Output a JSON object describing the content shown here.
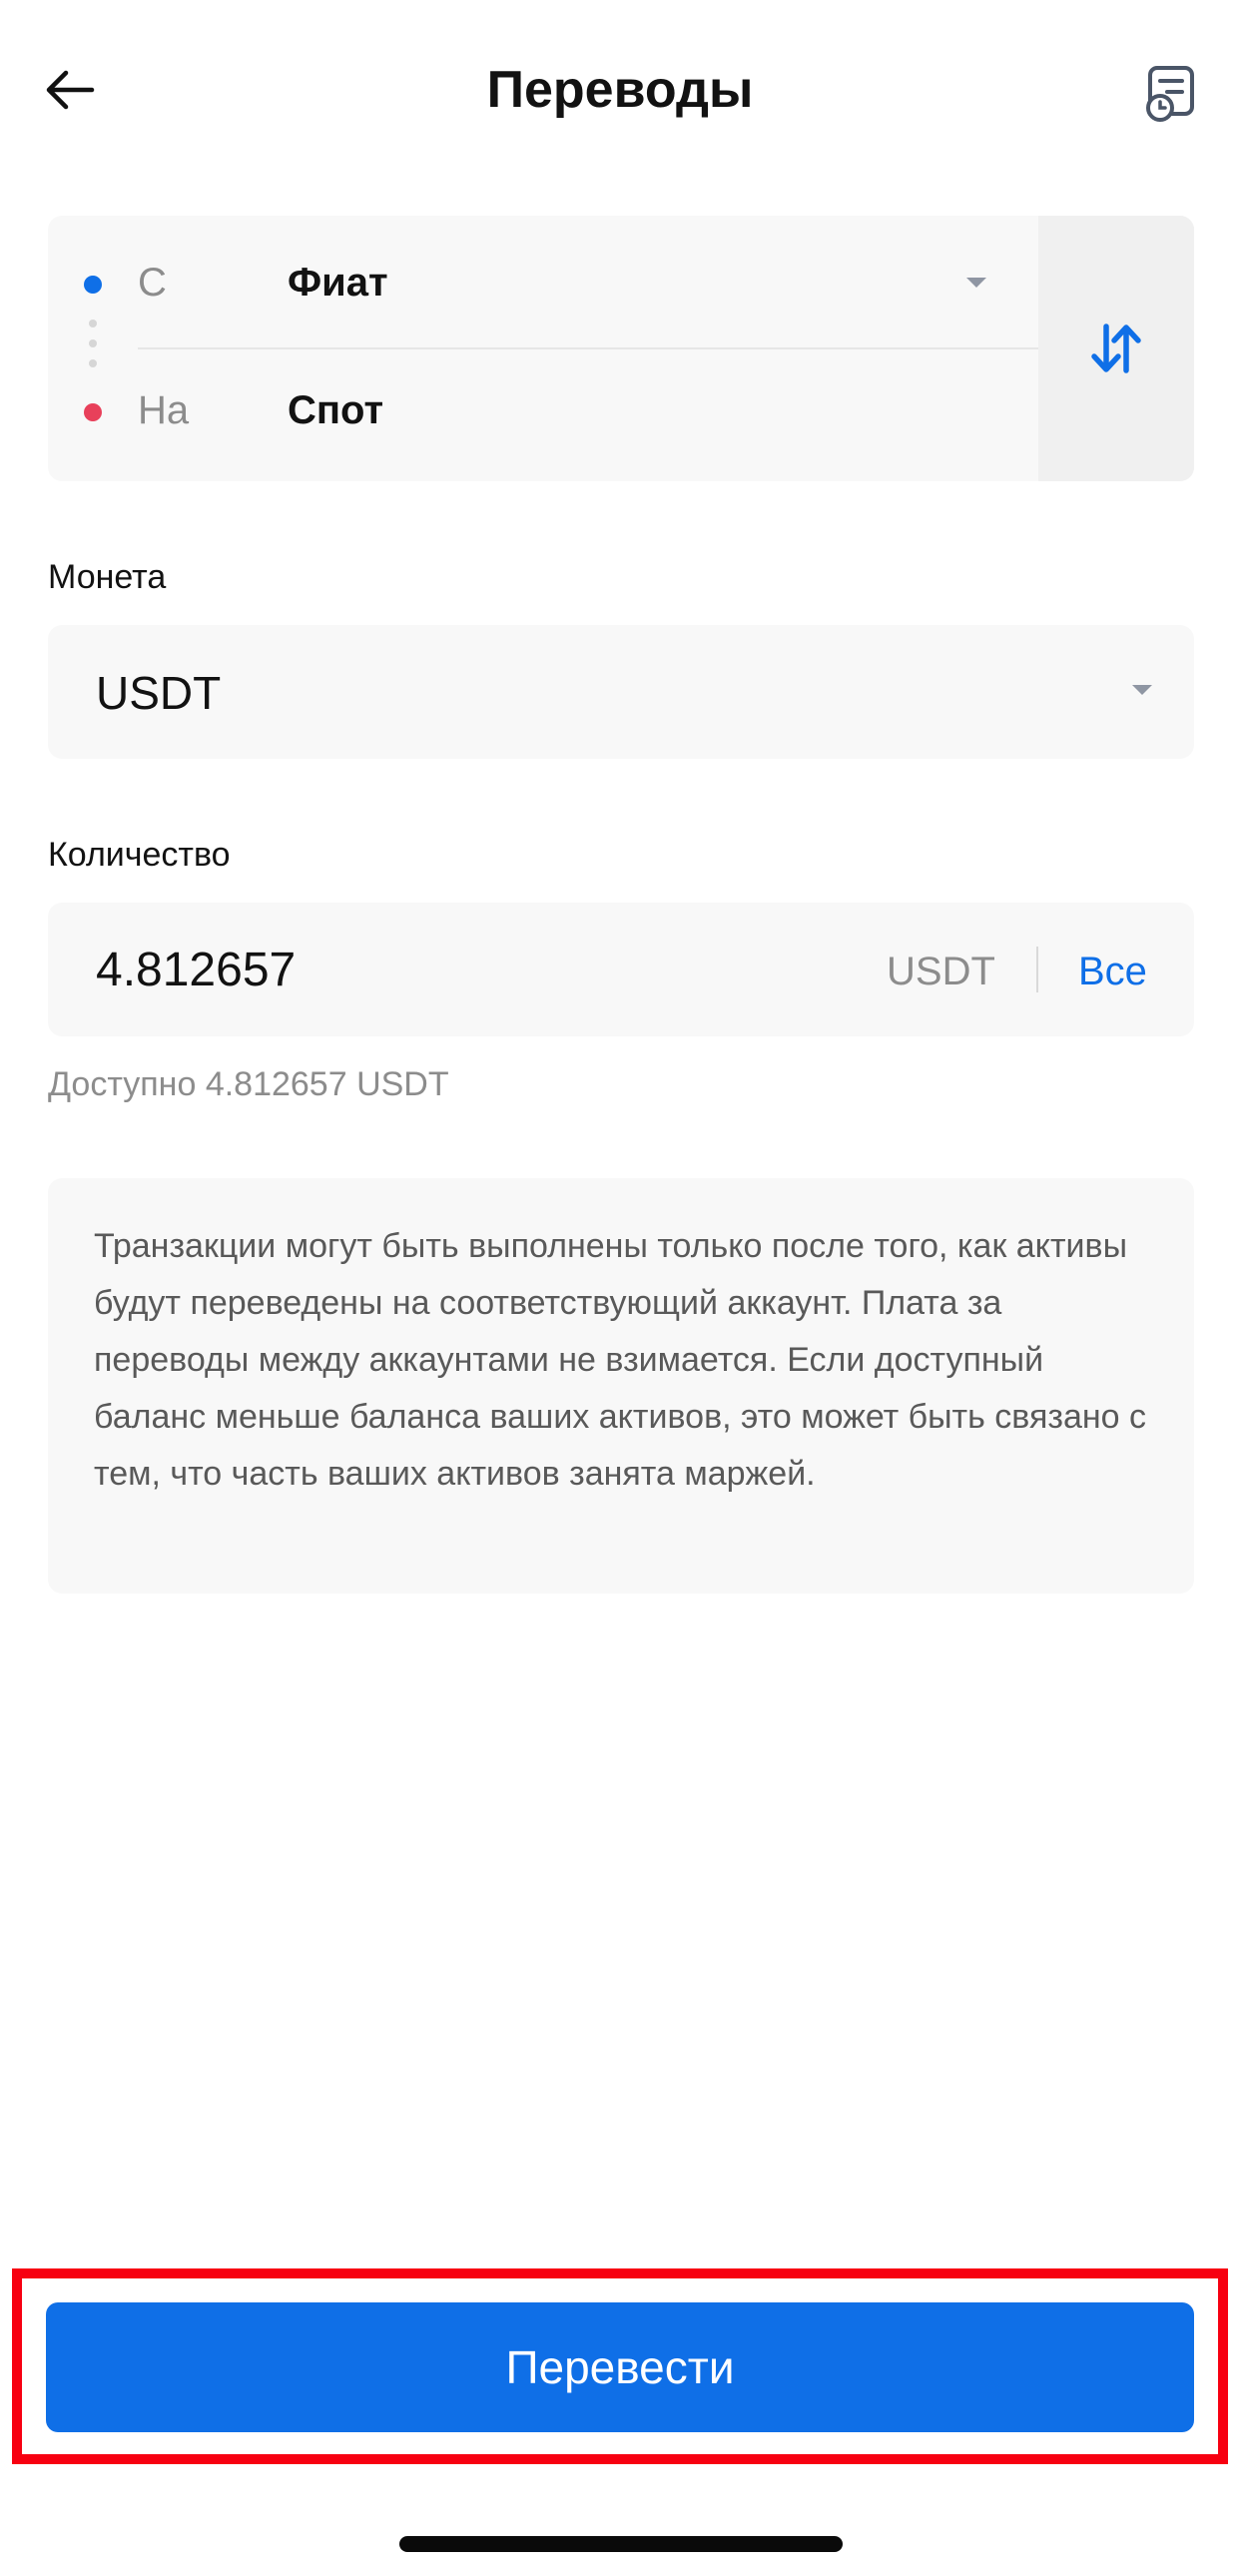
{
  "header": {
    "title": "Переводы",
    "back_icon": "arrow-left-icon",
    "history_icon": "transfer-history-icon"
  },
  "transfer": {
    "from_label": "С",
    "from_account": "Фиат",
    "to_label": "На",
    "to_account": "Спот",
    "swap_icon": "swap-arrows-icon",
    "from_dot_color": "#0f6fe7",
    "to_dot_color": "#e8405a"
  },
  "coin": {
    "label": "Монета",
    "value": "USDT"
  },
  "quantity": {
    "label": "Количество",
    "value": "4.812657",
    "unit": "USDT",
    "all_label": "Все",
    "available_text": "Доступно 4.812657 USDT"
  },
  "info": {
    "text": "Транзакции могут быть выполнены только после того, как активы будут переведены на соответствующий аккаунт. Плата за переводы между аккаунтами не взимается. Если доступный баланс меньше баланса ваших активов, это может быть связано с тем, что часть ваших активов занята маржей."
  },
  "action": {
    "submit_label": "Перевести"
  },
  "colors": {
    "accent": "#0f6fe7",
    "highlight": "#f70011"
  }
}
